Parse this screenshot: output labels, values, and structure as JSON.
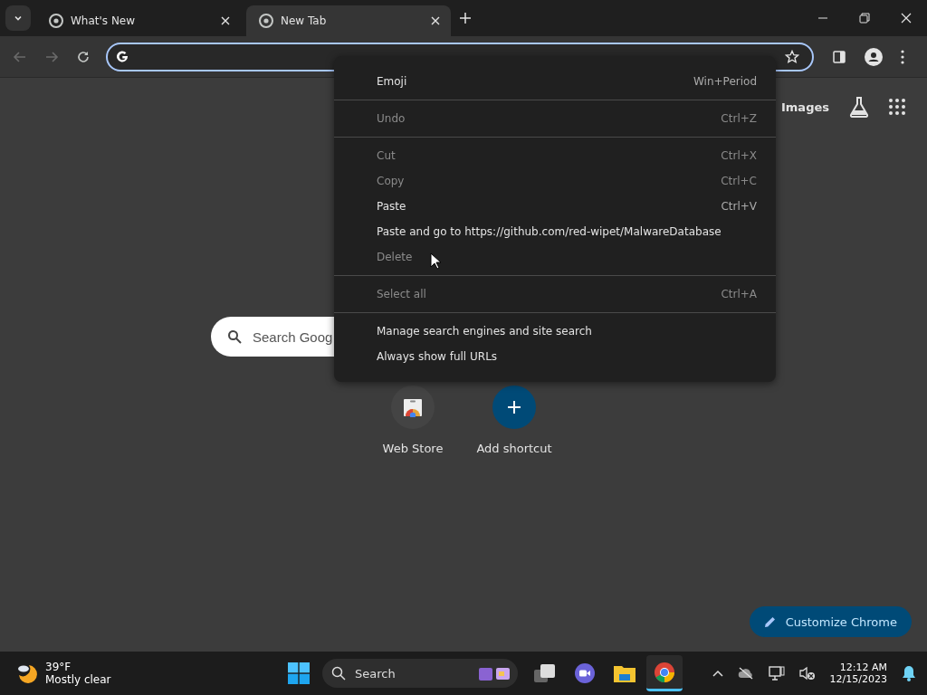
{
  "tabs": [
    {
      "title": "What's New",
      "selected": false
    },
    {
      "title": "New Tab",
      "selected": true
    }
  ],
  "page": {
    "header_links": [
      "Images"
    ],
    "search": {
      "placeholder": "Search Goog"
    },
    "shortcuts": [
      {
        "label": "Web Store",
        "kind": "store"
      },
      {
        "label": "Add shortcut",
        "kind": "add"
      }
    ],
    "customize_button": "Customize Chrome"
  },
  "context_menu": {
    "groups": [
      [
        {
          "label": "Emoji",
          "shortcut": "Win+Period",
          "disabled": false
        }
      ],
      [
        {
          "label": "Undo",
          "shortcut": "Ctrl+Z",
          "disabled": true
        }
      ],
      [
        {
          "label": "Cut",
          "shortcut": "Ctrl+X",
          "disabled": true
        },
        {
          "label": "Copy",
          "shortcut": "Ctrl+C",
          "disabled": true
        },
        {
          "label": "Paste",
          "shortcut": "Ctrl+V",
          "disabled": false
        },
        {
          "label": "Paste and go to https://github.com/red-wipet/MalwareDatabase",
          "disabled": false
        },
        {
          "label": "Delete",
          "disabled": true
        }
      ],
      [
        {
          "label": "Select all",
          "shortcut": "Ctrl+A",
          "disabled": true
        }
      ],
      [
        {
          "label": "Manage search engines and site search",
          "disabled": false
        },
        {
          "label": "Always show full URLs",
          "disabled": false
        }
      ]
    ]
  },
  "taskbar": {
    "weather": {
      "temp": "39°F",
      "condition": "Mostly clear"
    },
    "search": {
      "placeholder": "Search"
    },
    "apps": [
      {
        "kind": "taskview",
        "selected": false
      },
      {
        "kind": "meet",
        "selected": false
      },
      {
        "kind": "files",
        "selected": false
      },
      {
        "kind": "chrome",
        "selected": true
      }
    ],
    "clock": {
      "time": "12:12 AM",
      "date": "12/15/2023"
    }
  }
}
